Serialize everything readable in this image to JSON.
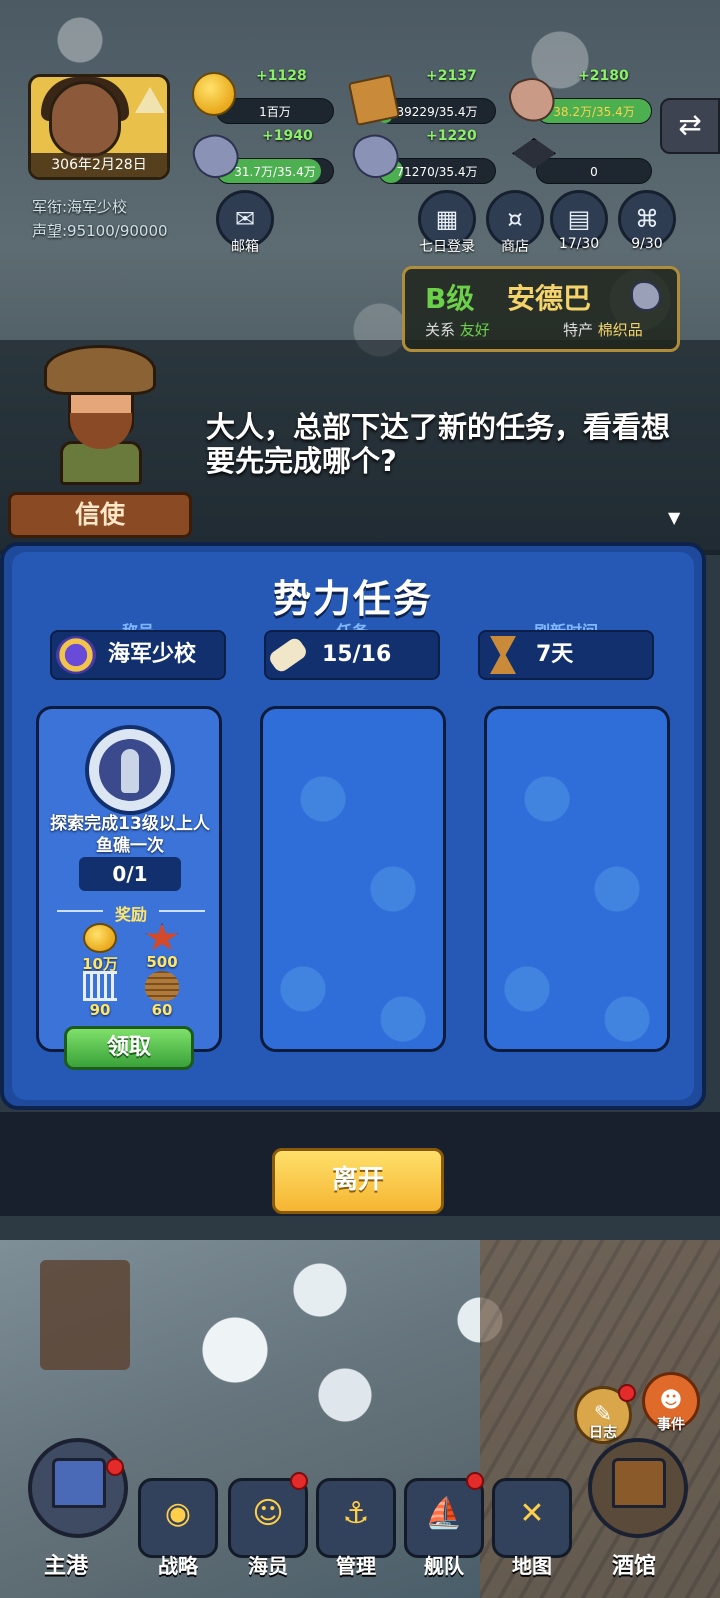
{
  "hud": {
    "date": "306年2月28日",
    "rank_label": "军衔:海军少校",
    "reputation_label": "声望:95100/90000",
    "resources": [
      {
        "icon": "gold-coin-icon",
        "delta": "+1128",
        "value": "1百万",
        "fill": 0
      },
      {
        "icon": "wood-crate-icon",
        "delta": "+2137",
        "value": "39229/35.4万",
        "fill": 0.11
      },
      {
        "icon": "stone-icon",
        "delta": "+2180",
        "value": "38.2万/35.4万",
        "fill": 1.0
      },
      {
        "icon": "iron-ore-icon",
        "delta": "+1940",
        "value": "31.7万/35.4万",
        "fill": 0.9
      },
      {
        "icon": "gem-ore-icon",
        "delta": "+1220",
        "value": "71270/35.4万",
        "fill": 0.2
      },
      {
        "icon": "graduation-cap-icon",
        "delta": "",
        "value": "0",
        "fill": 0
      }
    ],
    "buttons": [
      {
        "name": "mail",
        "icon": "envelope-icon",
        "label": "邮箱"
      },
      {
        "name": "seven-day-login",
        "icon": "calendar-icon",
        "label": "七日登录"
      },
      {
        "name": "shop",
        "icon": "money-bag-icon",
        "label": "商店"
      },
      {
        "name": "book",
        "icon": "book-icon",
        "label": "17/30"
      },
      {
        "name": "quest",
        "icon": "scroll-icon",
        "label": "9/30"
      }
    ],
    "nation": {
      "grade": "B级",
      "name": "安德巴",
      "relation_label": "关系",
      "relation_value": "友好",
      "product_label": "特产",
      "product_value": "棉织品"
    }
  },
  "dialog": {
    "speaker": "信使",
    "text": "大人，总部下达了新的任务，看看想要先完成哪个?"
  },
  "panel": {
    "title": "势力任务",
    "stats": [
      {
        "label": "称号",
        "value": "海军少校",
        "icon": "rank-badge-icon"
      },
      {
        "label": "任务",
        "value": "15/16",
        "icon": "scroll-icon"
      },
      {
        "label": "刷新时间",
        "value": "7天",
        "icon": "hourglass-icon"
      }
    ],
    "task": {
      "description": "探索完成13级以上人鱼礁一次",
      "progress": "0/1",
      "reward_header": "奖励",
      "rewards": [
        {
          "icon": "gold-coin-icon",
          "value": "10万"
        },
        {
          "icon": "star-medal-icon",
          "value": "500"
        },
        {
          "icon": "fish-bone-icon",
          "value": "90"
        },
        {
          "icon": "rope-coil-icon",
          "value": "60"
        }
      ],
      "claim_label": "领取"
    },
    "leave_label": "离开"
  },
  "side_buttons": [
    {
      "icon": "map-scroll-icon",
      "label": "日志"
    },
    {
      "icon": "demon-face-icon",
      "label": "事件"
    }
  ],
  "bottom_nav": {
    "home_label": "主港",
    "tavern_label": "酒馆",
    "items": [
      {
        "name": "strategy",
        "icon": "globe-icon",
        "label": "战略"
      },
      {
        "name": "crew",
        "icon": "sailor-icon",
        "label": "海员"
      },
      {
        "name": "manage",
        "icon": "anchor-icon",
        "label": "管理"
      },
      {
        "name": "fleet",
        "icon": "ship-icon",
        "label": "舰队"
      },
      {
        "name": "map",
        "icon": "map-icon",
        "label": "地图"
      }
    ]
  }
}
